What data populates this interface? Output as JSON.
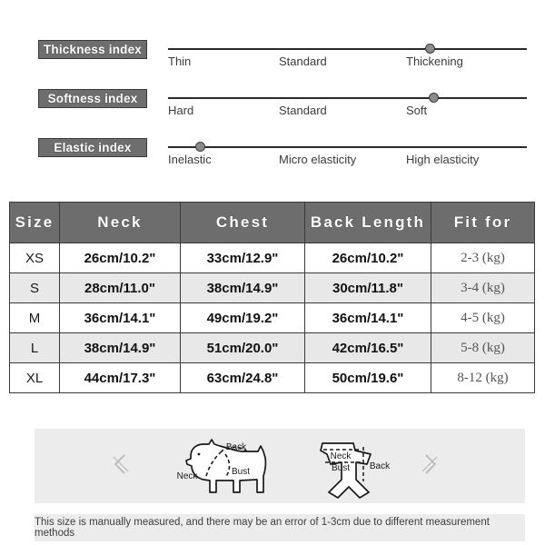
{
  "indices": {
    "rows": [
      {
        "badge": "Thickness index",
        "badge_icon": "index-badge",
        "ticks": [
          "Thin",
          "Standard",
          "Thickening"
        ],
        "marker_percent": 73
      },
      {
        "badge": "Softness index",
        "badge_icon": "index-badge",
        "ticks": [
          "Hard",
          "Standard",
          "Soft"
        ],
        "marker_percent": 74
      },
      {
        "badge": "Elastic index",
        "badge_icon": "index-badge",
        "ticks": [
          "Inelastic",
          "Micro elasticity",
          "High elasticity"
        ],
        "marker_percent": 9
      }
    ]
  },
  "size_table": {
    "headers": [
      "Size",
      "Neck",
      "Chest",
      "Back Length",
      "Fit for"
    ],
    "rows": [
      {
        "size": "XS",
        "neck": "26cm/10.2\"",
        "chest": "33cm/12.9\"",
        "back_length": "26cm/10.2\"",
        "fit_for": "2-3 (kg)"
      },
      {
        "size": "S",
        "neck": "28cm/11.0\"",
        "chest": "38cm/14.9\"",
        "back_length": "30cm/11.8\"",
        "fit_for": "3-4 (kg)"
      },
      {
        "size": "M",
        "neck": "36cm/14.1\"",
        "chest": "49cm/19.2\"",
        "back_length": "36cm/14.1\"",
        "fit_for": "4-5 (kg)"
      },
      {
        "size": "L",
        "neck": "38cm/14.9\"",
        "chest": "51cm/20.0\"",
        "back_length": "42cm/16.5\"",
        "fit_for": "5-8 (kg)"
      },
      {
        "size": "XL",
        "neck": "44cm/17.3\"",
        "chest": "63cm/24.8\"",
        "back_length": "50cm/19.6\"",
        "fit_for": "8-12 (kg)"
      }
    ]
  },
  "diagram": {
    "prev_icon": "chevron-left-icon",
    "next_icon": "chevron-right-icon",
    "dog": {
      "label_back": "Back",
      "label_neck": "Neck",
      "label_bust": "Bust"
    },
    "garment": {
      "label_neck": "Neck",
      "label_bust": "Bust",
      "label_back": "Back"
    }
  },
  "footer": {
    "note": "This size is manually measured, and there may be an error of 1-3cm due to different measurement methods"
  },
  "colors": {
    "badge_bg": "#6e6e6e",
    "header_bg": "#6d6d6d",
    "panel_bg": "#ececec",
    "row_alt_bg": "#e8e8e8",
    "line": "#2a2a2a"
  }
}
